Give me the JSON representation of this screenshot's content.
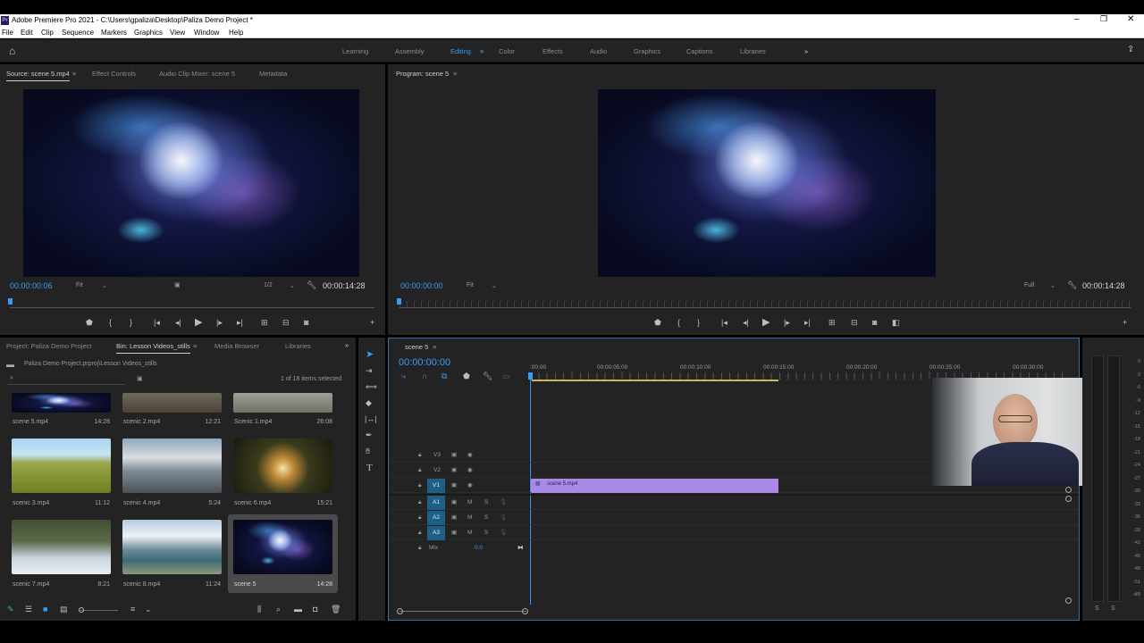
{
  "app": {
    "logo": "Pr",
    "title": "Adobe Premiere Pro 2021 - C:\\Users\\gpaliza\\Desktop\\Paliza Demo Project *"
  },
  "menu": [
    "File",
    "Edit",
    "Clip",
    "Sequence",
    "Markers",
    "Graphics",
    "View",
    "Window",
    "Help"
  ],
  "workspaces": [
    "Learning",
    "Assembly",
    "Editing",
    "Color",
    "Effects",
    "Audio",
    "Graphics",
    "Captions",
    "Libraries"
  ],
  "source_panel": {
    "tabs": [
      "Source: scene 5.mp4",
      "Effect Controls",
      "Audio Clip Mixer: scene 5",
      "Metadata"
    ],
    "timecode_in": "00:00:00:06",
    "fit": "Fit",
    "resolution": "1/2",
    "duration": "00:00:14:28"
  },
  "program_panel": {
    "tab": "Program: scene 5",
    "timecode_in": "00:00:00:00",
    "fit": "Fit",
    "resolution": "Full",
    "duration": "00:00:14:28"
  },
  "project_panel": {
    "tabs": [
      "Project: Paliza Demo Project",
      "Bin: Lesson Videos_stills",
      "Media Browser",
      "Libraries"
    ],
    "path": "Paliza Demo Project.prproj\\Lesson Videos_stills",
    "selection_status": "1 of 18 items selected",
    "items": [
      {
        "name": "scene 5.mp4",
        "duration": "14:28"
      },
      {
        "name": "scenic 2.mp4",
        "duration": "12:21"
      },
      {
        "name": "Scenic 1.mp4",
        "duration": "26:08"
      },
      {
        "name": "scenic 3.mp4",
        "duration": "11:12"
      },
      {
        "name": "scenic 4.mp4",
        "duration": "5:24"
      },
      {
        "name": "scenic 6.mp4",
        "duration": "15:21"
      },
      {
        "name": "scenic 7.mp4",
        "duration": "8:21"
      },
      {
        "name": "scenic 8.mp4",
        "duration": "11:24"
      },
      {
        "name": "scene 5",
        "duration": "14:28"
      }
    ]
  },
  "timeline": {
    "tab": "scene 5",
    "timecode": "00:00:00:00",
    "ruler": [
      ":00:00",
      "00:00:05:00",
      "00:00:10:00",
      "00:00:15:00",
      "00:00:20:00",
      "00:00:25:00",
      "00:00:30:00"
    ],
    "video_tracks": [
      "V3",
      "V2",
      "V1"
    ],
    "audio_tracks": [
      "A1",
      "A2",
      "A3"
    ],
    "mute_label": "M",
    "solo_label": "S",
    "mix_label": "Mix",
    "mix_value": "0.0",
    "clip_name": "scene 5.mp4"
  },
  "audio_meter": {
    "scale": [
      "0",
      "-3",
      "-6",
      "-9",
      "-12",
      "-15",
      "-18",
      "-21",
      "-24",
      "-27",
      "-30",
      "-33",
      "-36",
      "-39",
      "-42",
      "-45",
      "-48",
      "-51",
      "-dB"
    ],
    "solo_left": "S",
    "solo_right": "S"
  },
  "colors": {
    "accent_blue": "#3a9bf7",
    "panel_bg": "#232323",
    "clip_purple": "#a98ae6",
    "track_blue": "#1e5f86"
  }
}
